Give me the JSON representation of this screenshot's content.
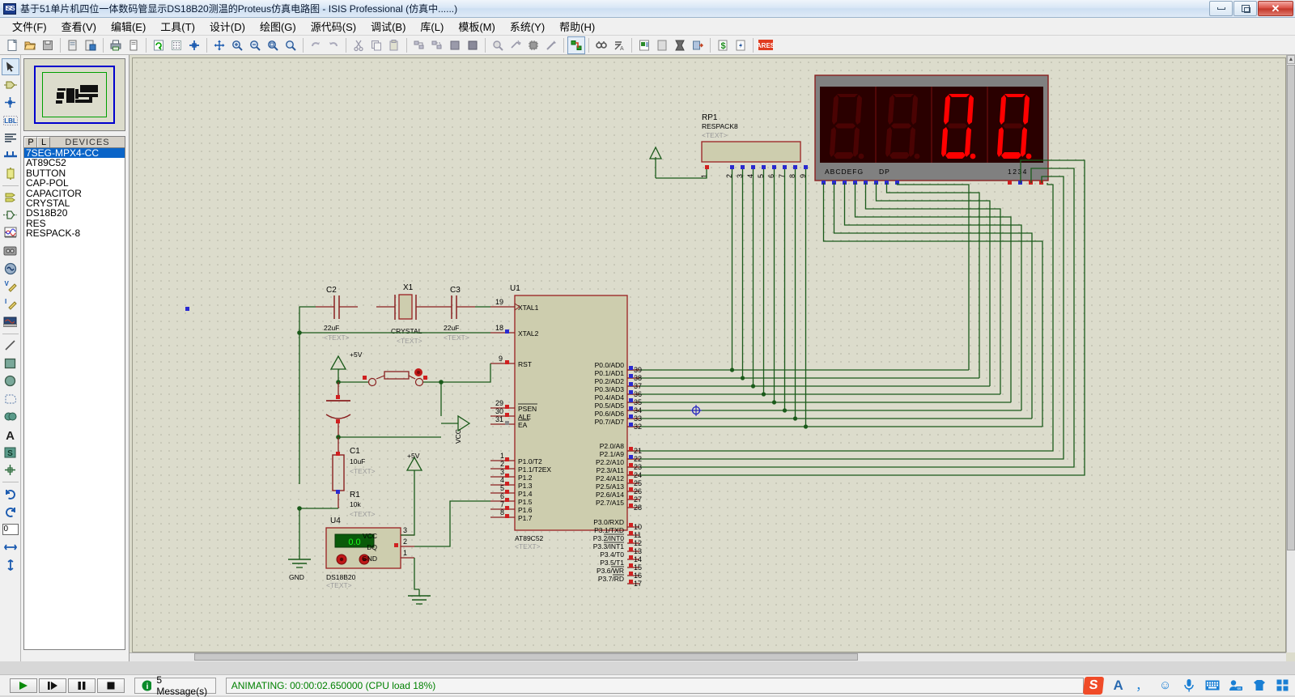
{
  "window": {
    "title": "基于51单片机四位一体数码管显示DS18B20测温的Proteus仿真电路图 - ISIS Professional (仿真中......)",
    "app_icon_label": "ISIS",
    "minimize_label": "",
    "restore_label": "",
    "close_label": "✕"
  },
  "menu": {
    "items": [
      {
        "label": "文件(F)"
      },
      {
        "label": "查看(V)"
      },
      {
        "label": "编辑(E)"
      },
      {
        "label": "工具(T)"
      },
      {
        "label": "设计(D)"
      },
      {
        "label": "绘图(G)"
      },
      {
        "label": "源代码(S)"
      },
      {
        "label": "调试(B)"
      },
      {
        "label": "库(L)"
      },
      {
        "label": "模板(M)"
      },
      {
        "label": "系统(Y)"
      },
      {
        "label": "帮助(H)"
      }
    ]
  },
  "toolbar": {
    "icons": [
      "new-file-icon",
      "open-file-icon",
      "save-file-icon",
      "import-section-icon",
      "export-section-icon",
      "print-icon",
      "print-area-icon",
      "refresh-icon",
      "toggle-grid-icon",
      "origin-icon",
      "pan-icon",
      "zoom-in-icon",
      "zoom-out-icon",
      "zoom-area-icon",
      "zoom-all-icon",
      "undo-icon",
      "redo-icon",
      "cut-icon",
      "copy-icon",
      "paste-icon",
      "block-copy-icon",
      "block-move-icon",
      "block-rotate-icon",
      "block-delete-icon",
      "pick-device-icon",
      "make-device-icon",
      "packaging-tool-icon",
      "decompose-icon",
      "wire-autorouter-icon",
      "search-tag-icon",
      "property-assignment-icon",
      "design-explorer-icon",
      "new-sheet-icon",
      "remove-sheet-icon",
      "exit-sheet-icon",
      "bill-of-materials-icon",
      "electrical-rule-check-icon",
      "netlist-ares-icon"
    ]
  },
  "vtoolbar": {
    "icons": [
      "selection-mode-icon",
      "component-mode-icon",
      "junction-dot-icon",
      "wire-label-icon",
      "text-script-icon",
      "bus-icon",
      "subcircuit-icon",
      "terminals-icon",
      "device-pin-icon",
      "graph-mode-icon",
      "tape-recorder-icon",
      "generator-icon",
      "voltage-probe-icon",
      "current-probe-icon",
      "virtual-instrument-icon",
      "line-icon",
      "box-icon",
      "circle-icon",
      "arc-icon",
      "path-icon",
      "text-icon",
      "symbol-icon",
      "marker-icon",
      "rotate-clockwise-icon",
      "rotate-anticlockwise-icon",
      "mirror-horizontal-icon",
      "mirror-vertical-icon"
    ],
    "rotation_value": "0"
  },
  "left_panel": {
    "preview_label": "preview-pane",
    "devices_header": {
      "p_button": "P",
      "l_button": "L",
      "title": "DEVICES"
    },
    "devices": [
      {
        "name": "7SEG-MPX4-CC",
        "selected": true
      },
      {
        "name": "AT89C52",
        "selected": false
      },
      {
        "name": "BUTTON",
        "selected": false
      },
      {
        "name": "CAP-POL",
        "selected": false
      },
      {
        "name": "CAPACITOR",
        "selected": false
      },
      {
        "name": "CRYSTAL",
        "selected": false
      },
      {
        "name": "DS18B20",
        "selected": false
      },
      {
        "name": "RES",
        "selected": false
      },
      {
        "name": "RESPACK-8",
        "selected": false
      }
    ]
  },
  "schematic": {
    "mcu": {
      "ref": "U1",
      "part": "AT89C52",
      "text_placeholder": "<TEXT>",
      "left_pins": [
        {
          "num": "19",
          "label": "XTAL1"
        },
        {
          "num": "18",
          "label": "XTAL2"
        },
        {
          "num": "9",
          "label": "RST"
        },
        {
          "num": "29",
          "label": "PSEN"
        },
        {
          "num": "30",
          "label": "ALE"
        },
        {
          "num": "31",
          "label": "EA"
        },
        {
          "num": "1",
          "label": "P1.0/T2"
        },
        {
          "num": "2",
          "label": "P1.1/T2EX"
        },
        {
          "num": "3",
          "label": "P1.2"
        },
        {
          "num": "4",
          "label": "P1.3"
        },
        {
          "num": "5",
          "label": "P1.4"
        },
        {
          "num": "6",
          "label": "P1.5"
        },
        {
          "num": "7",
          "label": "P1.6"
        },
        {
          "num": "8",
          "label": "P1.7"
        }
      ],
      "right_pins_p0": [
        {
          "num": "39",
          "label": "P0.0/AD0"
        },
        {
          "num": "38",
          "label": "P0.1/AD1"
        },
        {
          "num": "37",
          "label": "P0.2/AD2"
        },
        {
          "num": "36",
          "label": "P0.3/AD3"
        },
        {
          "num": "35",
          "label": "P0.4/AD4"
        },
        {
          "num": "34",
          "label": "P0.5/AD5"
        },
        {
          "num": "33",
          "label": "P0.6/AD6"
        },
        {
          "num": "32",
          "label": "P0.7/AD7"
        }
      ],
      "right_pins_p2": [
        {
          "num": "21",
          "label": "P2.0/A8"
        },
        {
          "num": "22",
          "label": "P2.1/A9"
        },
        {
          "num": "23",
          "label": "P2.2/A10"
        },
        {
          "num": "24",
          "label": "P2.3/A11"
        },
        {
          "num": "25",
          "label": "P2.4/A12"
        },
        {
          "num": "26",
          "label": "P2.5/A13"
        },
        {
          "num": "27",
          "label": "P2.6/A14"
        },
        {
          "num": "28",
          "label": "P2.7/A15"
        }
      ],
      "right_pins_p3": [
        {
          "num": "10",
          "label": "P3.0/RXD"
        },
        {
          "num": "11",
          "label": "P3.1/TXD"
        },
        {
          "num": "12",
          "label": "P3.2/INT0"
        },
        {
          "num": "13",
          "label": "P3.3/INT1"
        },
        {
          "num": "14",
          "label": "P3.4/T0"
        },
        {
          "num": "15",
          "label": "P3.5/T1"
        },
        {
          "num": "16",
          "label": "P3.6/WR"
        },
        {
          "num": "17",
          "label": "P3.7/RD"
        }
      ]
    },
    "components": [
      {
        "ref": "C2",
        "value": "22uF",
        "text": "<TEXT>"
      },
      {
        "ref": "X1",
        "value": "CRYSTAL",
        "text": "<TEXT>"
      },
      {
        "ref": "C3",
        "value": "22uF",
        "text": "<TEXT>"
      },
      {
        "ref": "C1",
        "value": "10uF",
        "text": "<TEXT>"
      },
      {
        "ref": "R1",
        "value": "10k",
        "text": "<TEXT>"
      },
      {
        "ref": "U4",
        "value": "DS18B20",
        "text": "<TEXT>"
      },
      {
        "ref": "RP1",
        "value": "RESPACK8",
        "text": "<TEXT>"
      }
    ],
    "ds18b20": {
      "ref": "U4",
      "part": "DS18B20",
      "reading": "0.0",
      "pins": [
        {
          "num": "3",
          "label": "VCC"
        },
        {
          "num": "2",
          "label": "DQ"
        },
        {
          "num": "1",
          "label": "GND"
        }
      ]
    },
    "respack": {
      "ref": "RP1",
      "part": "RESPACK8",
      "pin_numbers": [
        "1",
        "2",
        "3",
        "4",
        "5",
        "6",
        "7",
        "8",
        "9"
      ]
    },
    "power_labels": [
      {
        "label": "+5V"
      },
      {
        "label": "+5V"
      },
      {
        "label": "VCC"
      },
      {
        "label": "GND"
      }
    ],
    "display": {
      "part": "7SEG-MPX4-CC",
      "segment_label": "ABCDEFG",
      "dp_label": "DP",
      "digit_label": "1234",
      "digits": [
        "blank",
        "blank",
        "0",
        "0"
      ],
      "lit_color": "#ff0000",
      "dim_color": "#4a0303",
      "body_color": "#808080",
      "face_color": "#2a0000"
    }
  },
  "statusbar": {
    "play_label": "play-button",
    "step_label": "step-button",
    "pause_label": "pause-button",
    "stop_label": "stop-button",
    "messages": "5 Message(s)",
    "animating": "ANIMATING: 00:00:02.650000 (CPU load 18%)",
    "animating_color": "#008000"
  },
  "tray": {
    "items": [
      {
        "name": "sogou-ime-icon",
        "glyph": "S"
      },
      {
        "name": "input-mode-chinese-icon",
        "glyph": "A"
      },
      {
        "name": "punctuation-icon",
        "glyph": "，"
      },
      {
        "name": "emoji-icon",
        "glyph": "☺"
      },
      {
        "name": "microphone-icon",
        "glyph": "🎤"
      },
      {
        "name": "soft-keyboard-icon",
        "glyph": "⌨"
      },
      {
        "name": "user-account-icon",
        "glyph": "👤"
      },
      {
        "name": "skin-icon",
        "glyph": "👕"
      },
      {
        "name": "toolbox-icon",
        "glyph": "⊞"
      }
    ]
  }
}
